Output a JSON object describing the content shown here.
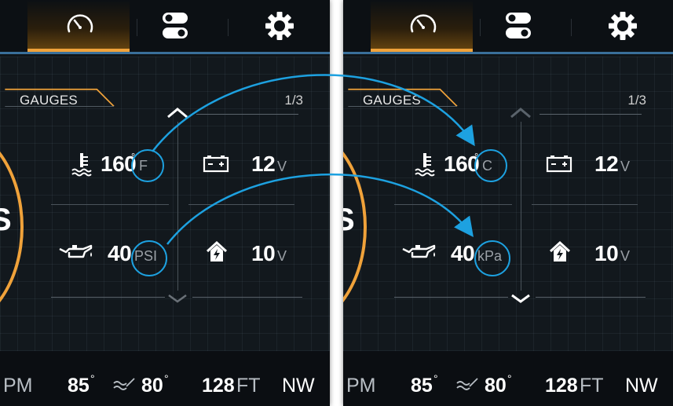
{
  "panels": [
    {
      "id": "left",
      "tabs": [
        {
          "name": "gauge",
          "icon": "speedometer-icon",
          "active": true
        },
        {
          "name": "toggles",
          "icon": "toggle-switches-icon",
          "active": false
        },
        {
          "name": "settings",
          "icon": "gear-icon",
          "active": false
        }
      ],
      "section_label": "GAUGES",
      "page_indicator": "1/3",
      "gauges": [
        {
          "icon": "coolant-temperature-icon",
          "value": "160",
          "degree": "°",
          "unit": "F"
        },
        {
          "icon": "battery-icon",
          "value": "12",
          "unit": "V"
        },
        {
          "icon": "oil-pressure-icon",
          "value": "40",
          "unit": "PSI"
        },
        {
          "icon": "house-battery-icon",
          "value": "10",
          "unit": "V"
        }
      ],
      "left_ring_letter": "S",
      "bottom": {
        "rpm_label": "PM",
        "temp1": "85",
        "temp1_deg": "°",
        "water_icon": "water-temperature-icon",
        "temp2": "80",
        "temp2_deg": "°",
        "depth_value": "128",
        "depth_unit": "FT",
        "heading": "NW"
      }
    },
    {
      "id": "right",
      "tabs": [
        {
          "name": "gauge",
          "icon": "speedometer-icon",
          "active": true
        },
        {
          "name": "toggles",
          "icon": "toggle-switches-icon",
          "active": false
        },
        {
          "name": "settings",
          "icon": "gear-icon",
          "active": false
        }
      ],
      "section_label": "GAUGES",
      "page_indicator": "1/3",
      "gauges": [
        {
          "icon": "coolant-temperature-icon",
          "value": "160",
          "degree": "°",
          "unit": "C"
        },
        {
          "icon": "battery-icon",
          "value": "12",
          "unit": "V"
        },
        {
          "icon": "oil-pressure-icon",
          "value": "40",
          "unit": "kPa"
        },
        {
          "icon": "house-battery-icon",
          "value": "10",
          "unit": "V"
        }
      ],
      "left_ring_letter": "S",
      "bottom": {
        "rpm_label": "PM",
        "temp1": "85",
        "temp1_deg": "°",
        "water_icon": "water-temperature-icon",
        "temp2": "80",
        "temp2_deg": "°",
        "depth_value": "128",
        "depth_unit": "FT",
        "heading": "NW"
      }
    }
  ],
  "colors": {
    "accent_orange": "#f0a23a",
    "highlight_blue": "#1da1e0",
    "background": "#12181d",
    "divider_blue": "#3a6f9a"
  },
  "annotations": [
    {
      "from": "F",
      "to": "C"
    },
    {
      "from": "PSI",
      "to": "kPa"
    }
  ]
}
